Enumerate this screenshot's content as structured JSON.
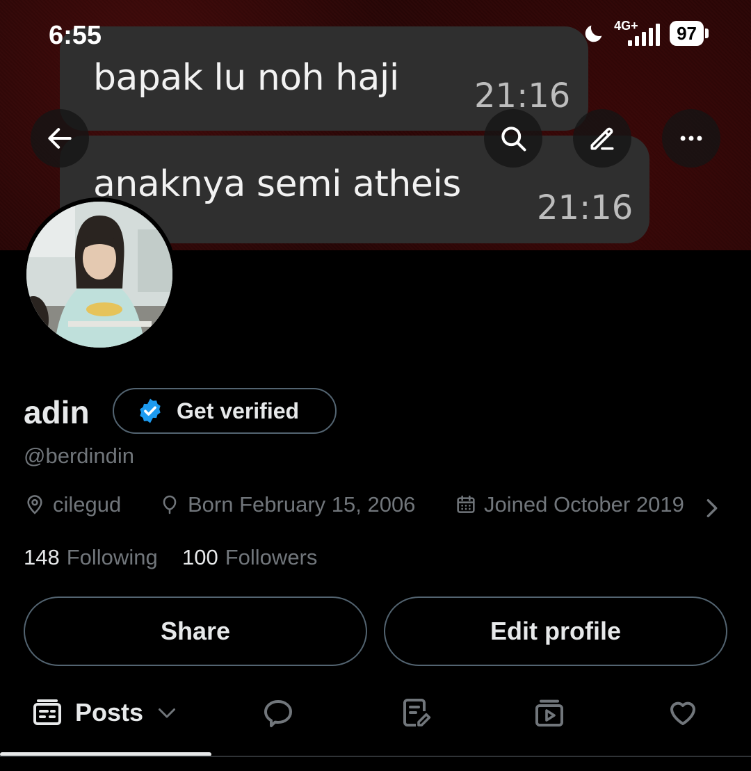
{
  "status_bar": {
    "time": "6:55",
    "network": "4G+",
    "battery": "97"
  },
  "banner": {
    "messages": [
      {
        "text": "bapak lu noh haji",
        "time": "21:16"
      },
      {
        "text": "anaknya semi atheis",
        "time": "21:16"
      }
    ]
  },
  "header": {
    "back_icon": "arrow-left-icon",
    "search_icon": "search-icon",
    "edit_icon": "pencil-icon",
    "more_icon": "more-horizontal-icon"
  },
  "profile": {
    "name": "adin",
    "verify_label": "Get verified",
    "handle": "@berdindin",
    "location": "cilegud",
    "birthday": "Born February 15, 2006",
    "joined": "Joined October 2019",
    "following_count": "148",
    "following_label": "Following",
    "followers_count": "100",
    "followers_label": "Followers"
  },
  "actions": {
    "share_label": "Share",
    "edit_label": "Edit profile"
  },
  "tabs": {
    "posts_label": "Posts",
    "icons": [
      "posts-icon",
      "replies-icon",
      "articles-icon",
      "media-icon",
      "likes-icon"
    ]
  },
  "colors": {
    "background": "#000000",
    "text_primary": "#e7e9ea",
    "text_secondary": "#71767b",
    "border": "#536471",
    "verified_blue": "#1d9bf0"
  }
}
